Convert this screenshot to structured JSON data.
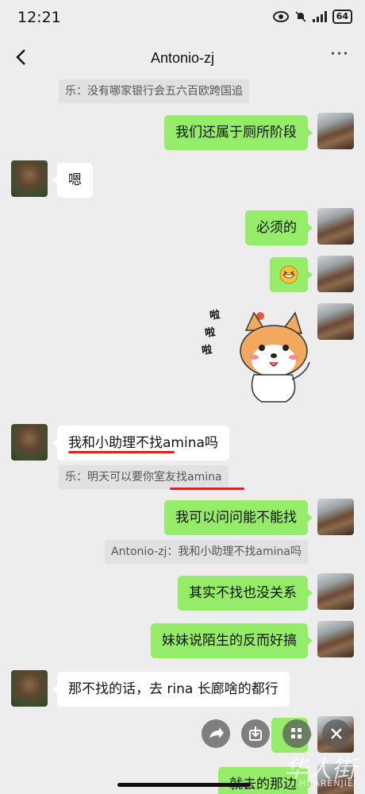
{
  "status_bar": {
    "time": "12:21",
    "battery": "64"
  },
  "header": {
    "title": "Antonio-zj"
  },
  "messages": [
    {
      "type": "quote",
      "text": "乐：没有哪家银行会五六百欧跨国追"
    },
    {
      "type": "sent",
      "text": "我们还属于厕所阶段"
    },
    {
      "type": "received",
      "text": "嗯"
    },
    {
      "type": "sent",
      "text": "必须的"
    },
    {
      "type": "sent",
      "text": "",
      "emoji": "grin-emoji"
    },
    {
      "type": "sticker",
      "sticker_text": "啦啦啦"
    },
    {
      "type": "received",
      "text": "我和小助理不找amina吗"
    },
    {
      "type": "quote",
      "text": "乐：明天可以要你室友找amina"
    },
    {
      "type": "sent",
      "text": "我可以问问能不能找"
    },
    {
      "type": "quote",
      "text": "Antonio-zj：我和小助理不找amina吗"
    },
    {
      "type": "sent",
      "text": "其实不找也没关系"
    },
    {
      "type": "sent",
      "text": "妹妹说陌生的反而好搞"
    },
    {
      "type": "received",
      "text": "那不找的话，去 rina 长廊啥的都行"
    },
    {
      "type": "sent",
      "text": "就去的那边"
    }
  ],
  "sticker": {
    "chars": [
      "啦",
      "啦",
      "啦"
    ]
  },
  "watermark": {
    "main": "华人街",
    "sub": "HUARENJIE"
  },
  "colors": {
    "sent_bubble": "#95ec69",
    "received_bubble": "#ffffff",
    "background": "#ededed",
    "annotation": "#d8261c"
  }
}
